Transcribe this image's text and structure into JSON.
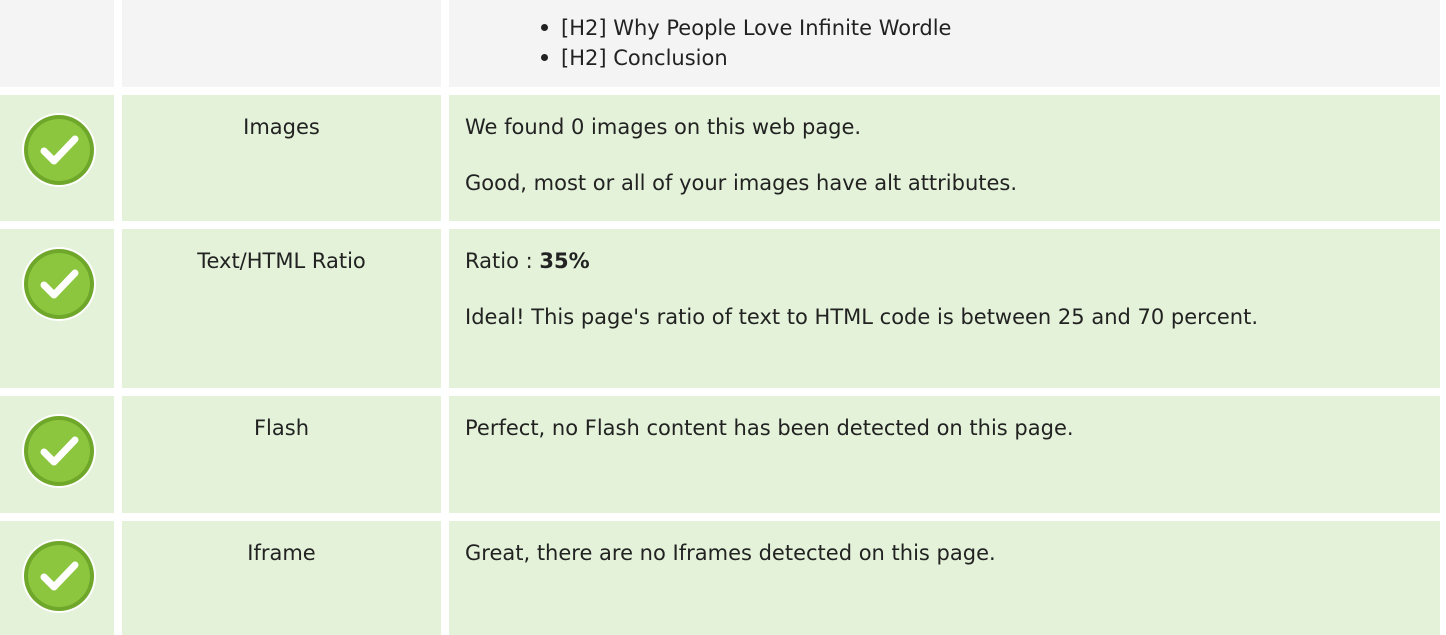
{
  "headings": {
    "items": [
      "[H2] Why People Love Infinite Wordle",
      "[H2] Conclusion"
    ]
  },
  "rows": {
    "images": {
      "name": "Images",
      "line1": "We found 0 images on this web page.",
      "line2": "Good, most or all of your images have alt attributes."
    },
    "ratio": {
      "name": "Text/HTML Ratio",
      "prefix": "Ratio : ",
      "value": "35%",
      "line2": "Ideal! This page's ratio of text to HTML code is between 25 and 70 percent."
    },
    "flash": {
      "name": "Flash",
      "line1": "Perfect, no Flash content has been detected on this page."
    },
    "iframe": {
      "name": "Iframe",
      "line1": "Great, there are no Iframes detected on this page."
    }
  },
  "colors": {
    "ok_background": "#e3f2d9",
    "neutral_background": "#f4f4f4",
    "check_icon": "#8cc63f"
  },
  "icons": {
    "status": "check-circle-icon"
  }
}
